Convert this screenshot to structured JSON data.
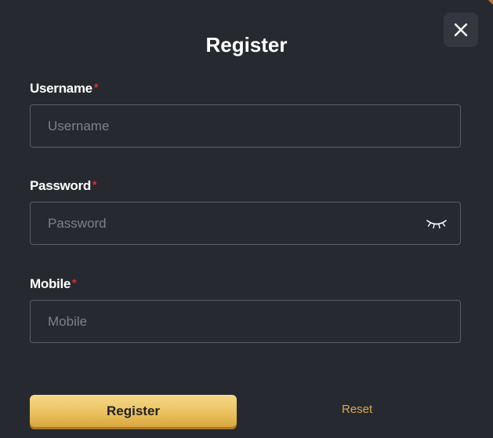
{
  "dialog": {
    "title": "Register",
    "close_icon": "close-icon"
  },
  "fields": {
    "username": {
      "label": "Username",
      "required_mark": "*",
      "placeholder": "Username",
      "value": ""
    },
    "password": {
      "label": "Password",
      "required_mark": "*",
      "placeholder": "Password",
      "value": "",
      "toggle_icon": "eye-closed-icon"
    },
    "mobile": {
      "label": "Mobile",
      "required_mark": "*",
      "placeholder": "Mobile",
      "value": ""
    }
  },
  "actions": {
    "register_label": "Register",
    "reset_label": "Reset"
  },
  "colors": {
    "background": "#272930",
    "accent_gold": "#e9bf5c",
    "reset_link": "#d9a94a",
    "required": "#e03030",
    "input_border": "#5b5e66"
  }
}
